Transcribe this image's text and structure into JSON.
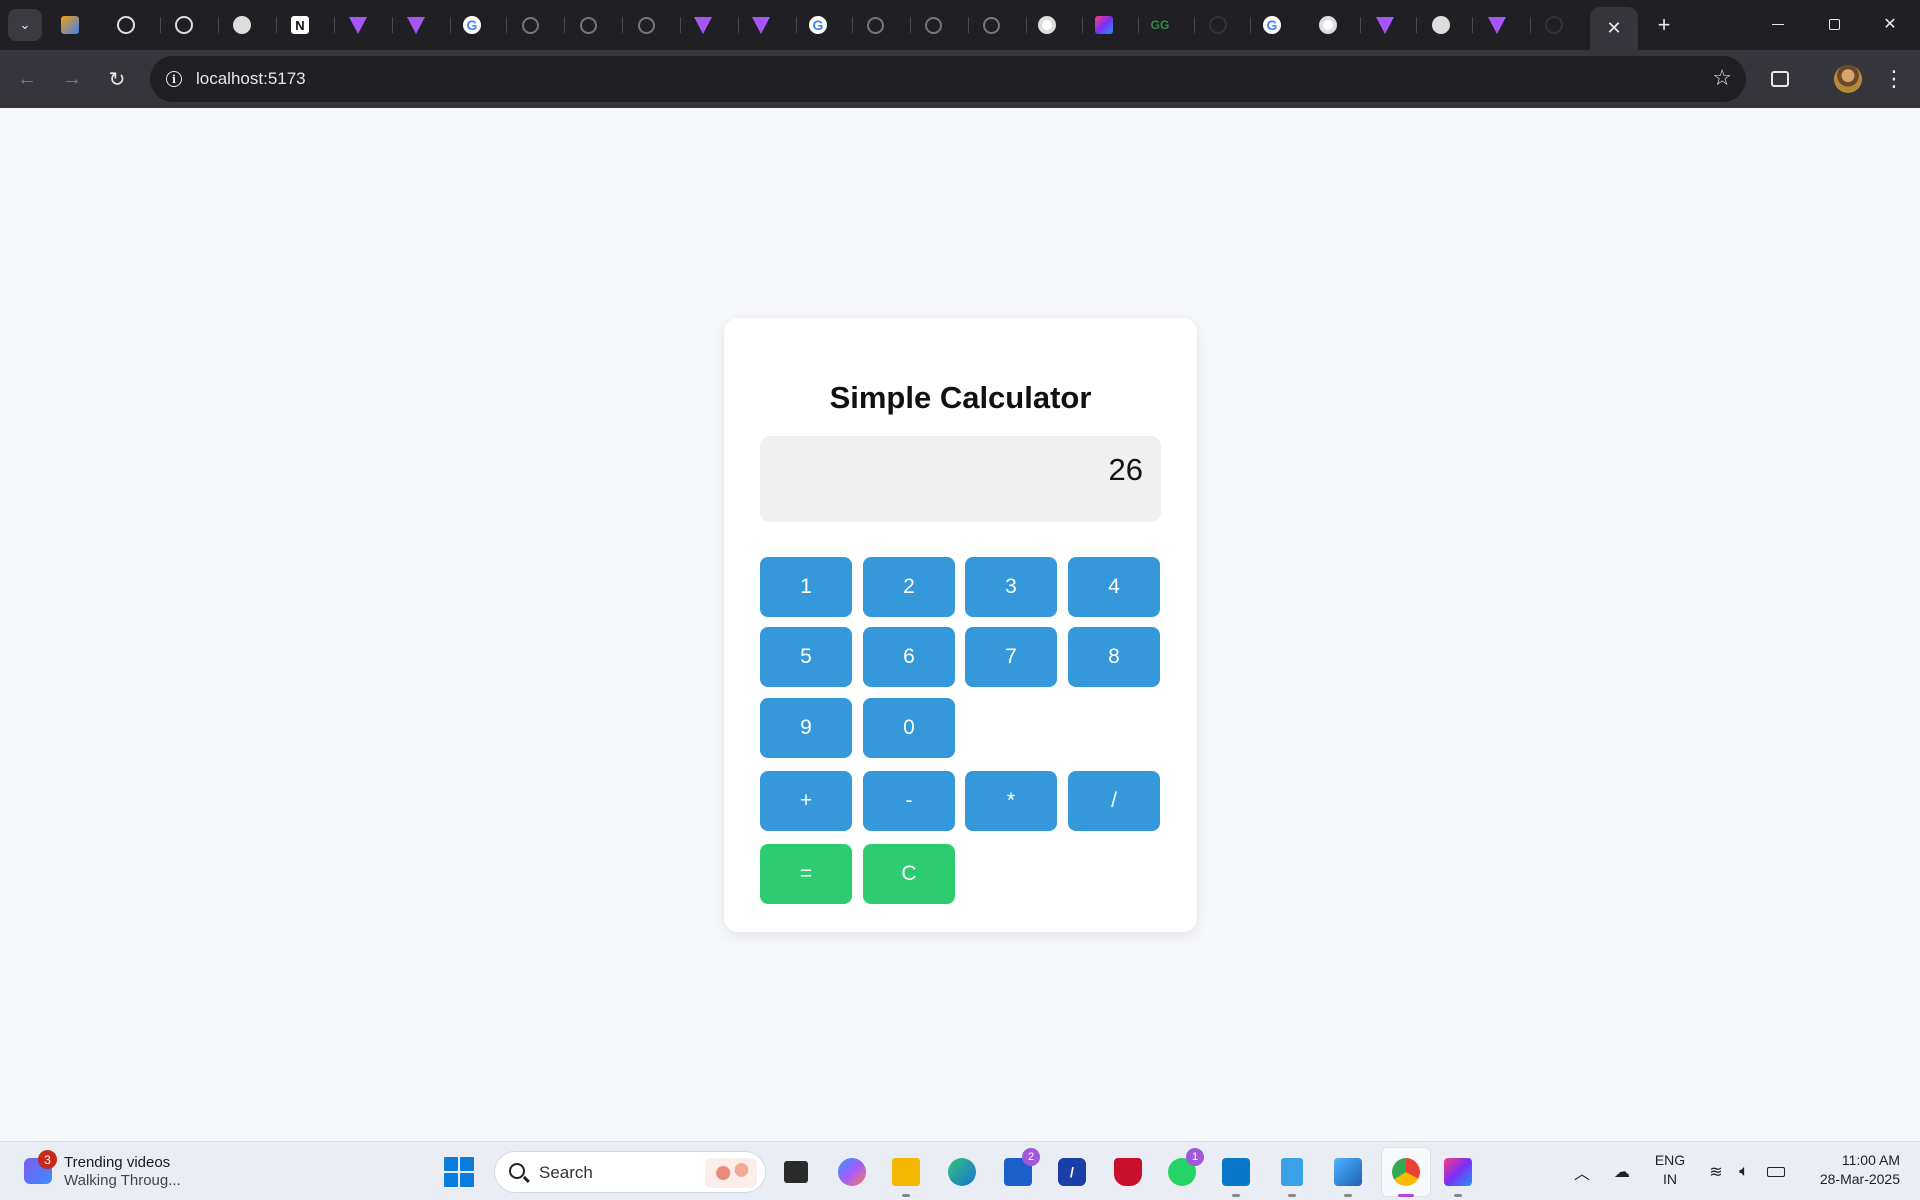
{
  "browser": {
    "url": "localhost:5173",
    "tabs": [
      {
        "icon": "arc-icon"
      },
      {
        "icon": "openai-icon"
      },
      {
        "icon": "openai-icon"
      },
      {
        "icon": "gear-icon"
      },
      {
        "icon": "notion-icon",
        "glyph": "N"
      },
      {
        "icon": "vite-icon"
      },
      {
        "icon": "vite-icon"
      },
      {
        "icon": "google-icon",
        "glyph": "G"
      },
      {
        "icon": "globe-icon"
      },
      {
        "icon": "globe-icon"
      },
      {
        "icon": "globe-icon"
      },
      {
        "icon": "vite-icon"
      },
      {
        "icon": "vite-icon"
      },
      {
        "icon": "google-icon",
        "glyph": "G"
      },
      {
        "icon": "globe-icon"
      },
      {
        "icon": "globe-icon"
      },
      {
        "icon": "globe-icon"
      },
      {
        "icon": "chrome-icon"
      },
      {
        "icon": "tasks-icon"
      },
      {
        "icon": "geeksforgeeks-icon",
        "glyph": "GG"
      },
      {
        "icon": "loading-icon"
      },
      {
        "icon": "google-icon",
        "glyph": "G"
      },
      {
        "icon": "chrome-icon"
      },
      {
        "icon": "vite-icon"
      },
      {
        "icon": "gear-icon"
      },
      {
        "icon": "vite-icon"
      },
      {
        "icon": "loading-icon"
      }
    ],
    "active_tab_close": "✕",
    "new_tab": "+"
  },
  "calculator": {
    "title": "Simple Calculator",
    "display": "26",
    "digits": [
      "1",
      "2",
      "3",
      "4",
      "5",
      "6",
      "7",
      "8",
      "9",
      "0"
    ],
    "operators": [
      "+",
      "-",
      "*",
      "/"
    ],
    "equals": "=",
    "clear": "C",
    "colors": {
      "number_button": "#3498db",
      "action_button": "#2ecc71",
      "background": "#f5f7fa"
    }
  },
  "taskbar": {
    "widget": {
      "badge": "3",
      "title": "Trending videos",
      "subtitle": "Walking Throug..."
    },
    "search_placeholder": "Search",
    "apps": [
      {
        "name": "task-view-icon"
      },
      {
        "name": "copilot-icon"
      },
      {
        "name": "file-explorer-icon"
      },
      {
        "name": "edge-icon"
      },
      {
        "name": "microsoft-store-icon",
        "badge": "2"
      },
      {
        "name": "app-icon"
      },
      {
        "name": "mcafee-icon"
      },
      {
        "name": "whatsapp-icon",
        "badge": "1"
      },
      {
        "name": "vscode-icon"
      },
      {
        "name": "notepad-icon"
      },
      {
        "name": "paint-icon"
      },
      {
        "name": "chrome-icon"
      },
      {
        "name": "tasks-icon"
      }
    ],
    "language": {
      "line1": "ENG",
      "line2": "IN"
    },
    "time": "11:00 AM",
    "date": "28-Mar-2025"
  }
}
